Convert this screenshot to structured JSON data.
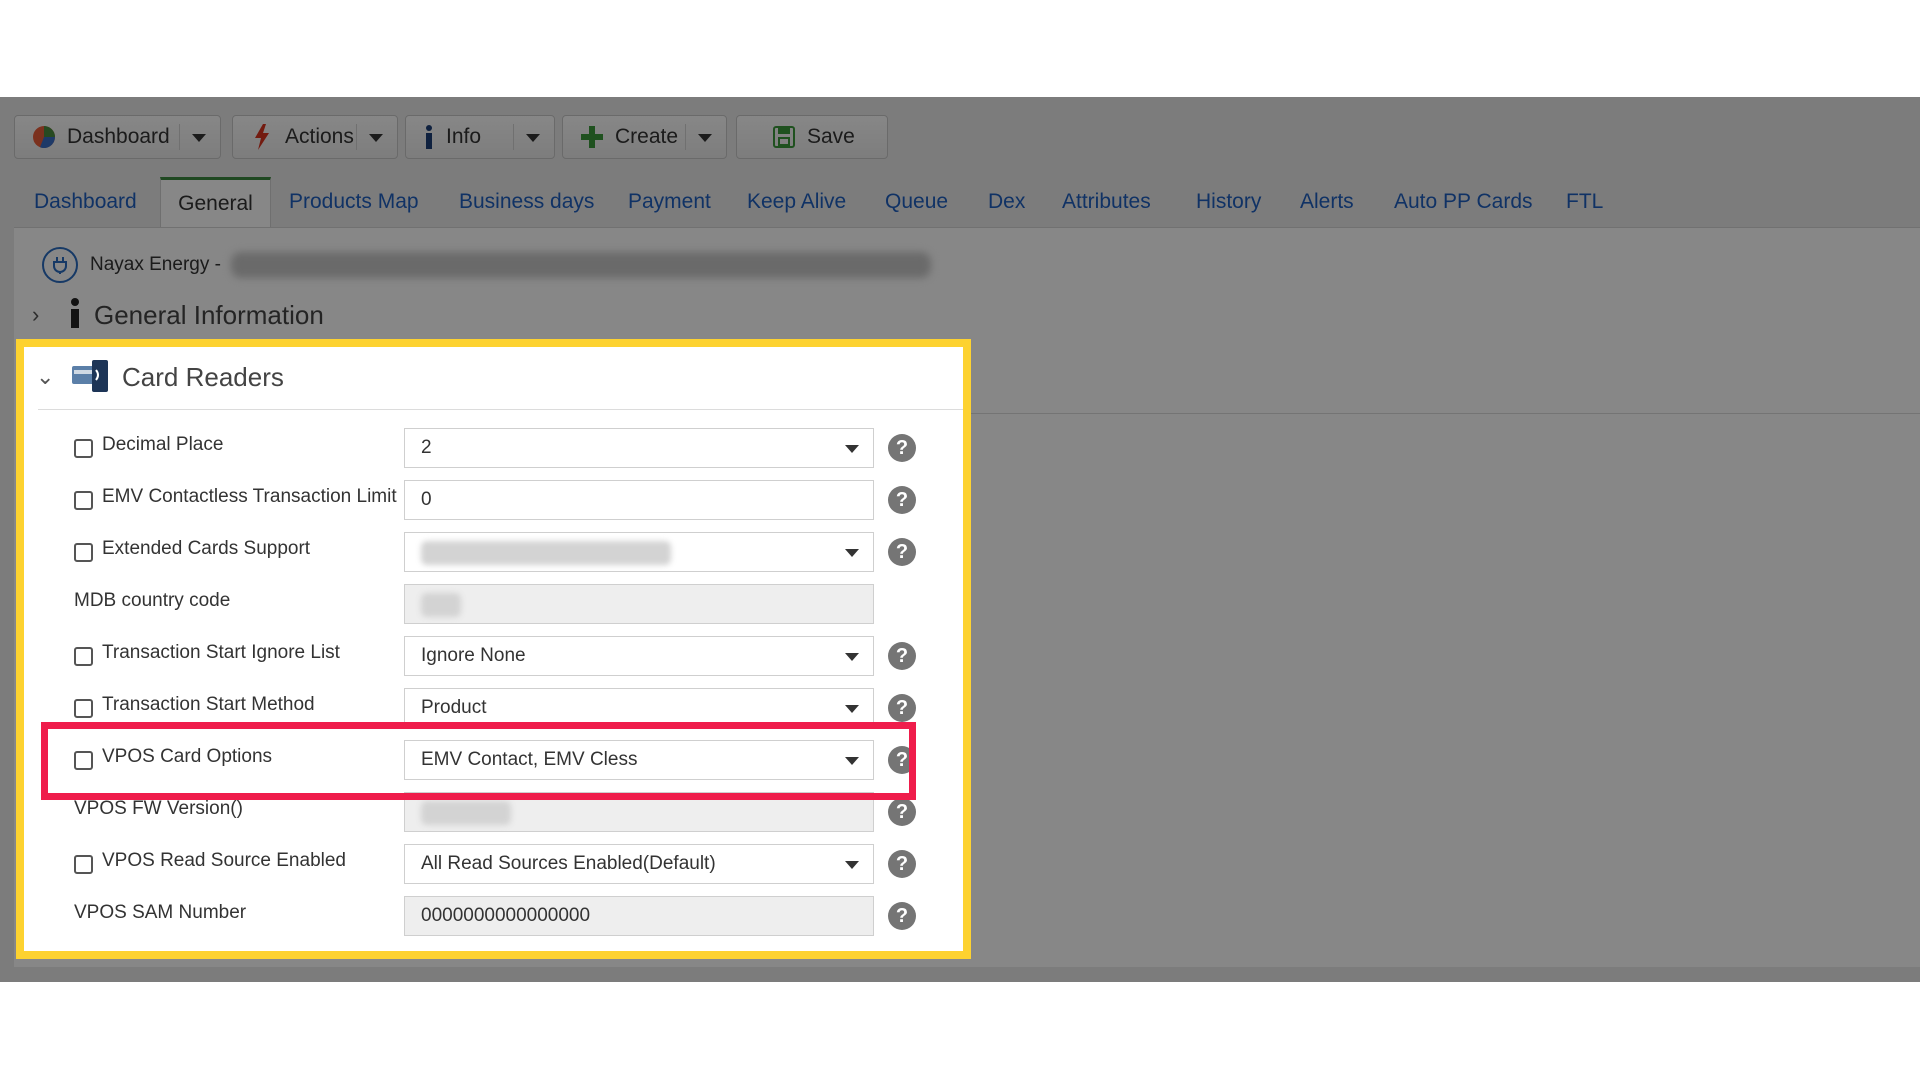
{
  "toolbar": {
    "dashboard_label": "Dashboard",
    "actions_label": "Actions",
    "info_label": "Info",
    "create_label": "Create",
    "save_label": "Save"
  },
  "tabs": [
    {
      "label": "Dashboard",
      "active": false
    },
    {
      "label": "General",
      "active": true
    },
    {
      "label": "Products Map",
      "active": false
    },
    {
      "label": "Business days",
      "active": false
    },
    {
      "label": "Payment",
      "active": false
    },
    {
      "label": "Keep Alive",
      "active": false
    },
    {
      "label": "Queue",
      "active": false
    },
    {
      "label": "Dex",
      "active": false
    },
    {
      "label": "Attributes",
      "active": false
    },
    {
      "label": "History",
      "active": false
    },
    {
      "label": "Alerts",
      "active": false
    },
    {
      "label": "Auto PP Cards",
      "active": false
    },
    {
      "label": "FTL",
      "active": false
    }
  ],
  "device": {
    "name": "Nayax Energy -"
  },
  "sections": {
    "general_info": "General Information",
    "card_readers": "Card Readers"
  },
  "fields": [
    {
      "label": "Decimal Place",
      "value": "2",
      "checkbox": true,
      "dropdown": true,
      "readonly": false
    },
    {
      "label": "EMV Contactless Transaction Limit",
      "value": "0",
      "checkbox": true,
      "dropdown": false,
      "readonly": false
    },
    {
      "label": "Extended Cards Support",
      "value": "",
      "checkbox": true,
      "dropdown": true,
      "readonly": false
    },
    {
      "label": "MDB country code",
      "value": "",
      "checkbox": false,
      "dropdown": false,
      "readonly": true
    },
    {
      "label": "Transaction Start Ignore List",
      "value": "Ignore None",
      "checkbox": true,
      "dropdown": true,
      "readonly": false
    },
    {
      "label": "Transaction Start Method",
      "value": "Product",
      "checkbox": true,
      "dropdown": true,
      "readonly": false
    },
    {
      "label": "VPOS Card Options",
      "value": "EMV Contact, EMV Cless",
      "checkbox": true,
      "dropdown": true,
      "readonly": false
    },
    {
      "label": "VPOS FW Version()",
      "value": "",
      "checkbox": false,
      "dropdown": false,
      "readonly": true
    },
    {
      "label": "VPOS Read Source Enabled",
      "value": "All Read Sources Enabled(Default)",
      "checkbox": true,
      "dropdown": true,
      "readonly": false
    },
    {
      "label": "VPOS SAM Number",
      "value": "0000000000000000",
      "checkbox": false,
      "dropdown": false,
      "readonly": true
    }
  ],
  "help_glyph": "?",
  "colors": {
    "spotlight_border": "#fdd230",
    "highlight_border": "#ef1d4b",
    "tab_link": "#1f5fbf",
    "active_tab_accent": "#3d8b40"
  }
}
